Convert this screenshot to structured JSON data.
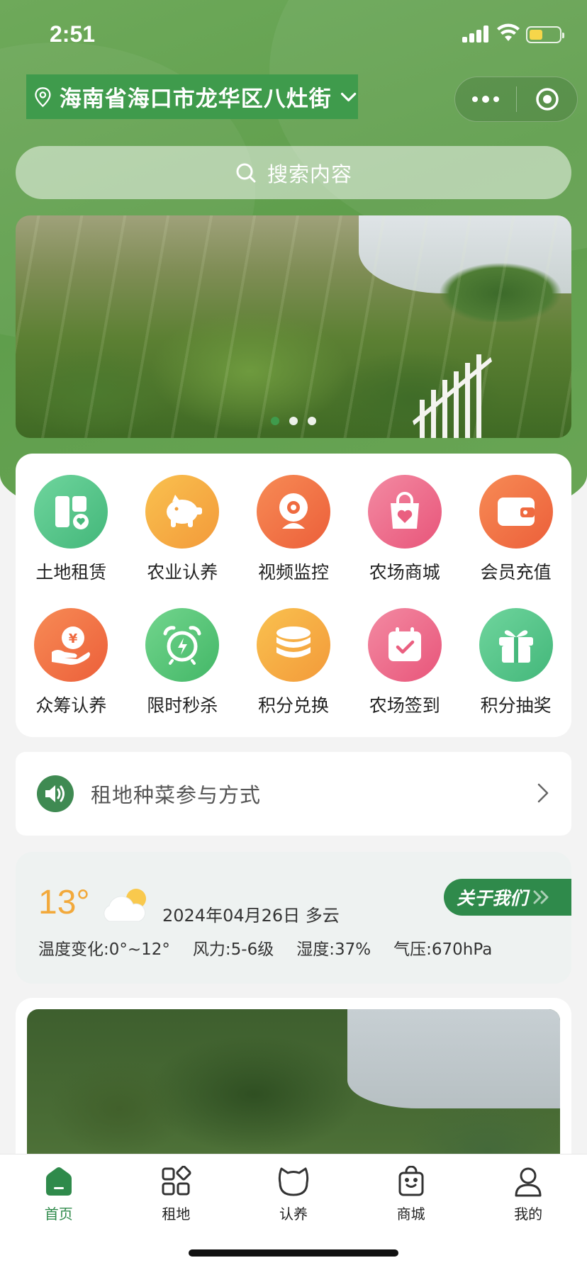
{
  "status_bar": {
    "time": "2:51"
  },
  "location": {
    "text": "海南省海口市龙华区八灶街"
  },
  "search": {
    "placeholder": "搜索内容"
  },
  "banner": {
    "slide_count": 3,
    "active_index": 0
  },
  "menu": [
    {
      "label": "土地租赁",
      "icon": "land-icon",
      "color": "#4cc08a"
    },
    {
      "label": "农业认养",
      "icon": "piggy-icon",
      "color": "#f5a943"
    },
    {
      "label": "视频监控",
      "icon": "camera-icon",
      "color": "#f0733f"
    },
    {
      "label": "农场商城",
      "icon": "shopping-bag-icon",
      "color": "#ee6b8a"
    },
    {
      "label": "会员充值",
      "icon": "wallet-icon",
      "color": "#f06a3e"
    },
    {
      "label": "众筹认养",
      "icon": "yen-hand-icon",
      "color": "#f06a3e"
    },
    {
      "label": "限时秒杀",
      "icon": "alarm-clock-icon",
      "color": "#4cc072"
    },
    {
      "label": "积分兑换",
      "icon": "coins-icon",
      "color": "#f5a943"
    },
    {
      "label": "农场签到",
      "icon": "calendar-check-icon",
      "color": "#ee6b8a"
    },
    {
      "label": "积分抽奖",
      "icon": "gift-icon",
      "color": "#4cc08a"
    }
  ],
  "notice": {
    "text": "租地种菜参与方式"
  },
  "weather": {
    "temp": "13°",
    "date_text": "2024年04月26日 多云",
    "temp_range": "温度变化:0°~12°",
    "wind": "风力:5-6级",
    "humidity": "湿度:37%",
    "pressure": "气压:670hPa",
    "about_label": "关于我们"
  },
  "tabbar": [
    {
      "label": "首页",
      "icon": "home-icon",
      "active": true
    },
    {
      "label": "租地",
      "icon": "grid-icon",
      "active": false
    },
    {
      "label": "认养",
      "icon": "cat-icon",
      "active": false
    },
    {
      "label": "商城",
      "icon": "shop-bag-icon",
      "active": false
    },
    {
      "label": "我的",
      "icon": "user-icon",
      "active": false
    }
  ],
  "colors": {
    "brand": "#3f9b4c",
    "accent_orange": "#f2a93b"
  }
}
